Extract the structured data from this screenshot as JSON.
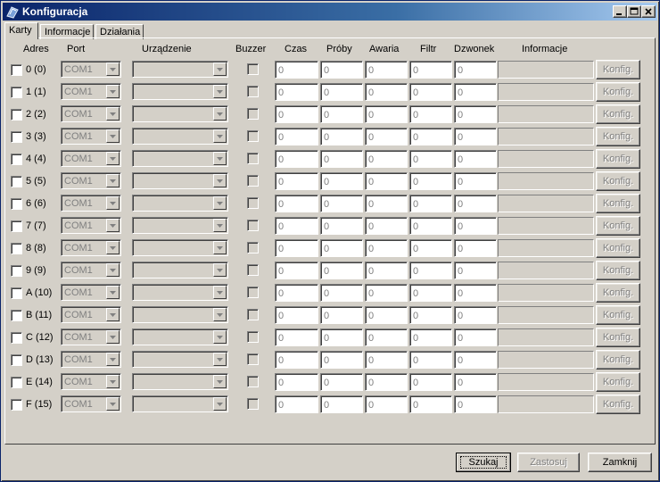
{
  "window": {
    "title": "Konfiguracja",
    "icons": [
      "app-icon",
      "minimize-icon",
      "maximize-icon",
      "close-icon"
    ]
  },
  "tabs": [
    {
      "label": "Karty",
      "active": true
    },
    {
      "label": "Informacje",
      "active": false
    },
    {
      "label": "Działania",
      "active": false
    }
  ],
  "columns": {
    "adres": "Adres",
    "port": "Port",
    "urzadzenie": "Urządzenie",
    "buzzer": "Buzzer",
    "czas": "Czas",
    "proby": "Próby",
    "awaria": "Awaria",
    "filtr": "Filtr",
    "dzwonek": "Dzwonek",
    "informacje": "Informacje"
  },
  "rows": [
    {
      "address": "0 (0)",
      "port": "COM1",
      "czas": "0",
      "proby": "0",
      "awaria": "0",
      "filtr": "0",
      "dzwonek": "0",
      "button": "Konfig."
    },
    {
      "address": "1 (1)",
      "port": "COM1",
      "czas": "0",
      "proby": "0",
      "awaria": "0",
      "filtr": "0",
      "dzwonek": "0",
      "button": "Konfig."
    },
    {
      "address": "2 (2)",
      "port": "COM1",
      "czas": "0",
      "proby": "0",
      "awaria": "0",
      "filtr": "0",
      "dzwonek": "0",
      "button": "Konfig."
    },
    {
      "address": "3 (3)",
      "port": "COM1",
      "czas": "0",
      "proby": "0",
      "awaria": "0",
      "filtr": "0",
      "dzwonek": "0",
      "button": "Konfig."
    },
    {
      "address": "4 (4)",
      "port": "COM1",
      "czas": "0",
      "proby": "0",
      "awaria": "0",
      "filtr": "0",
      "dzwonek": "0",
      "button": "Konfig."
    },
    {
      "address": "5 (5)",
      "port": "COM1",
      "czas": "0",
      "proby": "0",
      "awaria": "0",
      "filtr": "0",
      "dzwonek": "0",
      "button": "Konfig."
    },
    {
      "address": "6 (6)",
      "port": "COM1",
      "czas": "0",
      "proby": "0",
      "awaria": "0",
      "filtr": "0",
      "dzwonek": "0",
      "button": "Konfig."
    },
    {
      "address": "7 (7)",
      "port": "COM1",
      "czas": "0",
      "proby": "0",
      "awaria": "0",
      "filtr": "0",
      "dzwonek": "0",
      "button": "Konfig."
    },
    {
      "address": "8 (8)",
      "port": "COM1",
      "czas": "0",
      "proby": "0",
      "awaria": "0",
      "filtr": "0",
      "dzwonek": "0",
      "button": "Konfig."
    },
    {
      "address": "9 (9)",
      "port": "COM1",
      "czas": "0",
      "proby": "0",
      "awaria": "0",
      "filtr": "0",
      "dzwonek": "0",
      "button": "Konfig."
    },
    {
      "address": "A (10)",
      "port": "COM1",
      "czas": "0",
      "proby": "0",
      "awaria": "0",
      "filtr": "0",
      "dzwonek": "0",
      "button": "Konfig."
    },
    {
      "address": "B (11)",
      "port": "COM1",
      "czas": "0",
      "proby": "0",
      "awaria": "0",
      "filtr": "0",
      "dzwonek": "0",
      "button": "Konfig."
    },
    {
      "address": "C (12)",
      "port": "COM1",
      "czas": "0",
      "proby": "0",
      "awaria": "0",
      "filtr": "0",
      "dzwonek": "0",
      "button": "Konfig."
    },
    {
      "address": "D (13)",
      "port": "COM1",
      "czas": "0",
      "proby": "0",
      "awaria": "0",
      "filtr": "0",
      "dzwonek": "0",
      "button": "Konfig."
    },
    {
      "address": "E (14)",
      "port": "COM1",
      "czas": "0",
      "proby": "0",
      "awaria": "0",
      "filtr": "0",
      "dzwonek": "0",
      "button": "Konfig."
    },
    {
      "address": "F (15)",
      "port": "COM1",
      "czas": "0",
      "proby": "0",
      "awaria": "0",
      "filtr": "0",
      "dzwonek": "0",
      "button": "Konfig."
    }
  ],
  "footer": {
    "szukaj": "Szukaj",
    "zastosuj": "Zastosuj",
    "zamknij": "Zamknij"
  },
  "colors": {
    "title_bar_start": "#0a246a",
    "title_bar_end": "#a6caf0",
    "face": "#d4d0c8",
    "disabled_text": "#808080"
  }
}
